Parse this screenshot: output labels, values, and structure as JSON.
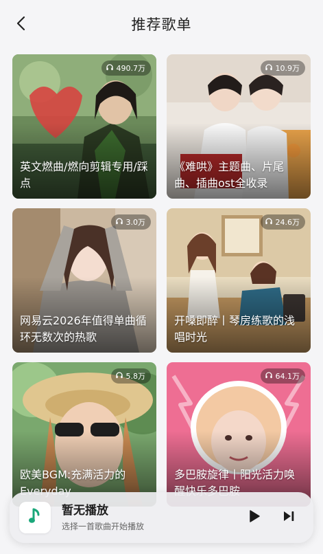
{
  "header": {
    "title": "推荐歌单"
  },
  "playlists": [
    {
      "title": "英文燃曲/燃向剪辑专用/踩点",
      "plays": "490.7万"
    },
    {
      "title": "《难哄》主题曲、片尾曲、插曲ost全收录",
      "plays": "10.9万"
    },
    {
      "title": "网易云2026年值得单曲循环无数次的热歌",
      "plays": "3.0万"
    },
    {
      "title": "开嗓即醉丨琴房练歌的浅唱时光",
      "plays": "24.6万"
    },
    {
      "title": "欧美BGM:充满活力的Everyday",
      "plays": "5.8万"
    },
    {
      "title": "多巴胺旋律丨阳光活力唤醒快乐多巴胺",
      "plays": "64.1万"
    }
  ],
  "player": {
    "title": "暂无播放",
    "subtitle": "选择一首歌曲开始播放",
    "accent": "#1aa77a"
  }
}
